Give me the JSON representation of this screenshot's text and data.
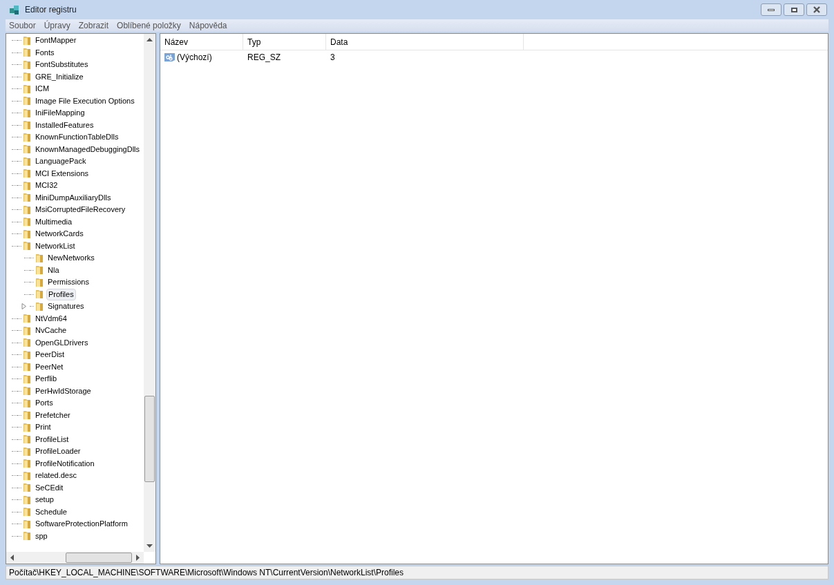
{
  "window": {
    "title": "Editor registru"
  },
  "menu": [
    "Soubor",
    "Úpravy",
    "Zobrazit",
    "Oblíbené položky",
    "Nápověda"
  ],
  "tree": [
    {
      "label": "FontMapper",
      "selected": false,
      "expander": false
    },
    {
      "label": "Fonts",
      "selected": false,
      "expander": false
    },
    {
      "label": "FontSubstitutes",
      "selected": false,
      "expander": false
    },
    {
      "label": "GRE_Initialize",
      "selected": false,
      "expander": false
    },
    {
      "label": "ICM",
      "selected": false,
      "expander": false
    },
    {
      "label": "Image File Execution Options",
      "selected": false,
      "expander": false
    },
    {
      "label": "IniFileMapping",
      "selected": false,
      "expander": false
    },
    {
      "label": "InstalledFeatures",
      "selected": false,
      "expander": false
    },
    {
      "label": "KnownFunctionTableDlls",
      "selected": false,
      "expander": false
    },
    {
      "label": "KnownManagedDebuggingDlls",
      "selected": false,
      "expander": false
    },
    {
      "label": "LanguagePack",
      "selected": false,
      "expander": false
    },
    {
      "label": "MCI Extensions",
      "selected": false,
      "expander": false
    },
    {
      "label": "MCI32",
      "selected": false,
      "expander": false
    },
    {
      "label": "MiniDumpAuxiliaryDlls",
      "selected": false,
      "expander": false
    },
    {
      "label": "MsiCorruptedFileRecovery",
      "selected": false,
      "expander": false
    },
    {
      "label": "Multimedia",
      "selected": false,
      "expander": false
    },
    {
      "label": "NetworkCards",
      "selected": false,
      "expander": false
    },
    {
      "label": "NetworkList",
      "selected": false,
      "expander": false,
      "children": [
        {
          "label": "NewNetworks",
          "selected": false,
          "expander": false
        },
        {
          "label": "Nla",
          "selected": false,
          "expander": false
        },
        {
          "label": "Permissions",
          "selected": false,
          "expander": false
        },
        {
          "label": "Profiles",
          "selected": true,
          "expander": false
        },
        {
          "label": "Signatures",
          "selected": false,
          "expander": true
        }
      ]
    },
    {
      "label": "NtVdm64",
      "selected": false,
      "expander": false
    },
    {
      "label": "NvCache",
      "selected": false,
      "expander": false
    },
    {
      "label": "OpenGLDrivers",
      "selected": false,
      "expander": false
    },
    {
      "label": "PeerDist",
      "selected": false,
      "expander": false
    },
    {
      "label": "PeerNet",
      "selected": false,
      "expander": false
    },
    {
      "label": "Perflib",
      "selected": false,
      "expander": false
    },
    {
      "label": "PerHwIdStorage",
      "selected": false,
      "expander": false
    },
    {
      "label": "Ports",
      "selected": false,
      "expander": false
    },
    {
      "label": "Prefetcher",
      "selected": false,
      "expander": false
    },
    {
      "label": "Print",
      "selected": false,
      "expander": false
    },
    {
      "label": "ProfileList",
      "selected": false,
      "expander": false
    },
    {
      "label": "ProfileLoader",
      "selected": false,
      "expander": false
    },
    {
      "label": "ProfileNotification",
      "selected": false,
      "expander": false
    },
    {
      "label": "related.desc",
      "selected": false,
      "expander": false
    },
    {
      "label": "SeCEdit",
      "selected": false,
      "expander": false
    },
    {
      "label": "setup",
      "selected": false,
      "expander": false
    },
    {
      "label": "Schedule",
      "selected": false,
      "expander": false
    },
    {
      "label": "SoftwareProtectionPlatform",
      "selected": false,
      "expander": false
    },
    {
      "label": "spp",
      "selected": false,
      "expander": false
    }
  ],
  "table": {
    "columns": [
      "Název",
      "Typ",
      "Data"
    ],
    "rows": [
      {
        "cells": [
          "(Výchozí)",
          "REG_SZ",
          "3"
        ]
      }
    ]
  },
  "status_bar": "Počítač\\HKEY_LOCAL_MACHINE\\SOFTWARE\\Microsoft\\Windows NT\\CurrentVersion\\NetworkList\\Profiles"
}
